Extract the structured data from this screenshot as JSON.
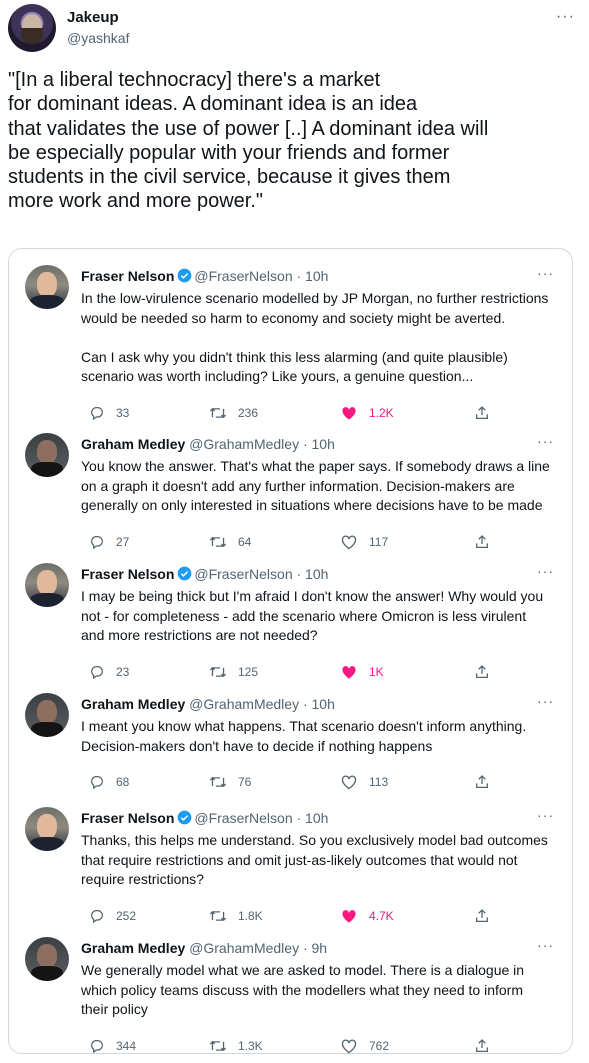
{
  "author": {
    "name": "Jakeup",
    "handle": "@yashkaf"
  },
  "more_label": "···",
  "main_text": "\"[In a liberal technocracy] there's a market\nfor dominant ideas. A dominant idea is an idea\nthat validates the use of power [..] A dominant idea will\nbe especially popular with your friends and former\nstudents in the civil service, because it gives them\nmore work and more power.\"",
  "thread": [
    {
      "name": "Fraser Nelson",
      "handle": "@FraserNelson · 10h",
      "verified": true,
      "avatar": "fraser",
      "text": "In the low-virulence scenario modelled by JP Morgan, no further restrictions\nwould be needed so harm to economy and society might be averted.\n\nCan I ask why you didn't think this less alarming (and quite plausible)\nscenario was worth including? Like yours, a genuine question...",
      "replies": "33",
      "retweets": "236",
      "likes": "1.2K",
      "liked": true
    },
    {
      "name": "Graham Medley",
      "handle": "@GrahamMedley · 10h",
      "verified": false,
      "avatar": "graham",
      "text": "You know the answer. That's what the paper says. If somebody draws a line\non a graph it doesn't add any further information. Decision-makers are\ngenerally on only interested in situations where decisions have to be made",
      "replies": "27",
      "retweets": "64",
      "likes": "117",
      "liked": false
    },
    {
      "name": "Fraser Nelson",
      "handle": "@FraserNelson · 10h",
      "verified": true,
      "avatar": "fraser",
      "text": "I may be being thick but I'm afraid I don't know the answer! Why would you\nnot - for completeness - add the scenario where Omicron is less virulent\nand more restrictions are not needed?",
      "replies": "23",
      "retweets": "125",
      "likes": "1K",
      "liked": true
    },
    {
      "name": "Graham Medley",
      "handle": "@GrahamMedley · 10h",
      "verified": false,
      "avatar": "graham",
      "text": "I meant you know what happens. That scenario doesn't inform anything.\nDecision-makers don't have to decide if nothing happens",
      "replies": "68",
      "retweets": "76",
      "likes": "113",
      "liked": false
    },
    {
      "name": "Fraser Nelson",
      "handle": "@FraserNelson · 10h",
      "verified": true,
      "avatar": "fraser",
      "text": "Thanks, this helps me understand. So you exclusively model bad outcomes\nthat require restrictions and omit just-as-likely outcomes that would not\nrequire restrictions?",
      "replies": "252",
      "retweets": "1.8K",
      "likes": "4.7K",
      "liked": true
    },
    {
      "name": "Graham Medley",
      "handle": "@GrahamMedley · 9h",
      "verified": false,
      "avatar": "graham",
      "text": "We generally model what we are asked to model. There is a dialogue in\nwhich policy teams discuss with the modellers what they need to inform\ntheir policy",
      "replies": "344",
      "retweets": "1.3K",
      "likes": "762",
      "liked": false
    }
  ],
  "colors": {
    "like": "#f91880",
    "verified": "#1d9bf0",
    "muted": "#536471",
    "border": "#cfd9de"
  },
  "icons": [
    "reply-icon",
    "retweet-icon",
    "like-icon",
    "share-icon",
    "verified-badge-icon"
  ]
}
